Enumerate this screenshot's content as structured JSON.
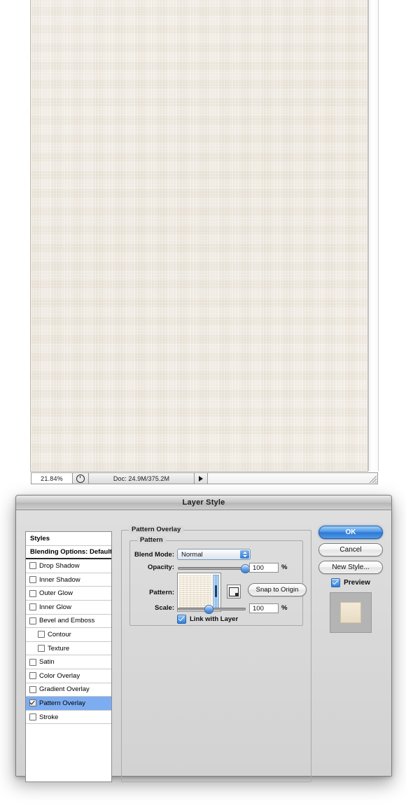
{
  "document_window": {
    "canvas_texture_color": "#ece5d9",
    "status_bar": {
      "zoom_level": "21.84%",
      "clock_icon": "clock-icon",
      "doc_info": "Doc: 24.9M/375.2M",
      "arrow_icon": "triangle-right-icon",
      "resize_grip_icon": "resize-grip-icon"
    }
  },
  "dialog": {
    "title": "Layer Style",
    "styles_list": [
      {
        "label": "Styles",
        "type": "header",
        "indent": false,
        "checkbox": false,
        "checked": false,
        "selected": false,
        "divider": "thin"
      },
      {
        "label": "Blending Options: Default",
        "type": "header",
        "indent": false,
        "checkbox": false,
        "checked": false,
        "selected": false,
        "divider": "thick"
      },
      {
        "label": "Drop Shadow",
        "type": "effect",
        "indent": false,
        "checkbox": true,
        "checked": false,
        "selected": false,
        "divider": "thin"
      },
      {
        "label": "Inner Shadow",
        "type": "effect",
        "indent": false,
        "checkbox": true,
        "checked": false,
        "selected": false,
        "divider": "thin"
      },
      {
        "label": "Outer Glow",
        "type": "effect",
        "indent": false,
        "checkbox": true,
        "checked": false,
        "selected": false,
        "divider": "thin"
      },
      {
        "label": "Inner Glow",
        "type": "effect",
        "indent": false,
        "checkbox": true,
        "checked": false,
        "selected": false,
        "divider": "thin"
      },
      {
        "label": "Bevel and Emboss",
        "type": "effect",
        "indent": false,
        "checkbox": true,
        "checked": false,
        "selected": false,
        "divider": "thin"
      },
      {
        "label": "Contour",
        "type": "suboption",
        "indent": true,
        "checkbox": true,
        "checked": false,
        "selected": false,
        "divider": "thin"
      },
      {
        "label": "Texture",
        "type": "suboption",
        "indent": true,
        "checkbox": true,
        "checked": false,
        "selected": false,
        "divider": "thin"
      },
      {
        "label": "Satin",
        "type": "effect",
        "indent": false,
        "checkbox": true,
        "checked": false,
        "selected": false,
        "divider": "thin"
      },
      {
        "label": "Color Overlay",
        "type": "effect",
        "indent": false,
        "checkbox": true,
        "checked": false,
        "selected": false,
        "divider": "thin"
      },
      {
        "label": "Gradient Overlay",
        "type": "effect",
        "indent": false,
        "checkbox": true,
        "checked": false,
        "selected": false,
        "divider": "thin"
      },
      {
        "label": "Pattern Overlay",
        "type": "effect",
        "indent": false,
        "checkbox": true,
        "checked": true,
        "selected": true,
        "divider": "thin"
      },
      {
        "label": "Stroke",
        "type": "effect",
        "indent": false,
        "checkbox": true,
        "checked": false,
        "selected": false,
        "divider": "thin"
      }
    ],
    "panel": {
      "group_title": "Pattern Overlay",
      "subgroup_title": "Pattern",
      "blend_mode": {
        "label": "Blend Mode:",
        "value": "Normal"
      },
      "opacity": {
        "label": "Opacity:",
        "value": "100",
        "unit": "%",
        "slider_percent": 100
      },
      "pattern": {
        "label": "Pattern:",
        "preset_icon": "pattern-preset-icon",
        "snap_button": "Snap to Origin"
      },
      "scale": {
        "label": "Scale:",
        "value": "100",
        "unit": "%",
        "slider_percent": 40
      },
      "link_with_layer": {
        "label": "Link with Layer",
        "checked": true
      }
    },
    "buttons": {
      "ok": "OK",
      "cancel": "Cancel",
      "new_style": "New Style...",
      "preview_label": "Preview",
      "preview_checked": true
    },
    "colors": {
      "selection_blue": "#7dadf0",
      "primary_button_blue": "#2d78d4",
      "dialog_gray": "#d6d6d6"
    }
  }
}
